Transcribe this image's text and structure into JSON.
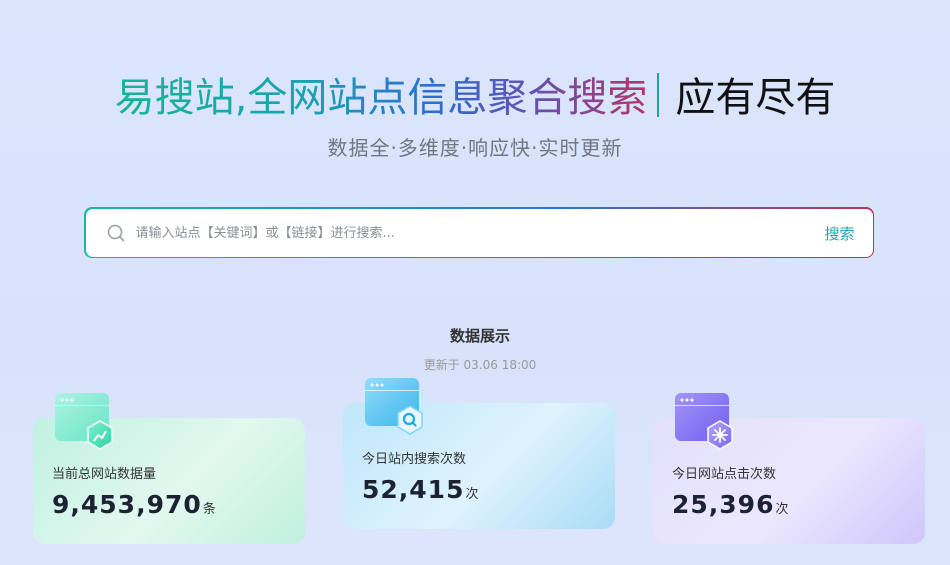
{
  "hero": {
    "title_main": "易搜站,全网站点信息聚合搜索",
    "title_tail": "应有尽有",
    "subtitle": "数据全·多维度·响应快·实时更新"
  },
  "search": {
    "placeholder": "请输入站点【关键词】或【链接】进行搜索...",
    "value": "",
    "button_label": "搜索"
  },
  "stats": {
    "section_title": "数据展示",
    "updated_prefix": "更新于",
    "updated_time": "03.06 18:00",
    "cards": [
      {
        "label": "当前总网站数据量",
        "value": "9,453,970",
        "unit": "条",
        "icon": "chart-trend-icon"
      },
      {
        "label": "今日站内搜索次数",
        "value": "52,415",
        "unit": "次",
        "icon": "magnifier-icon"
      },
      {
        "label": "今日网站点击次数",
        "value": "25,396",
        "unit": "次",
        "icon": "click-icon"
      }
    ]
  },
  "colors": {
    "brand_teal": "#16b493",
    "brand_blue": "#2c6ed0",
    "brand_red": "#b0386e",
    "search_button": "#22a6b4"
  }
}
